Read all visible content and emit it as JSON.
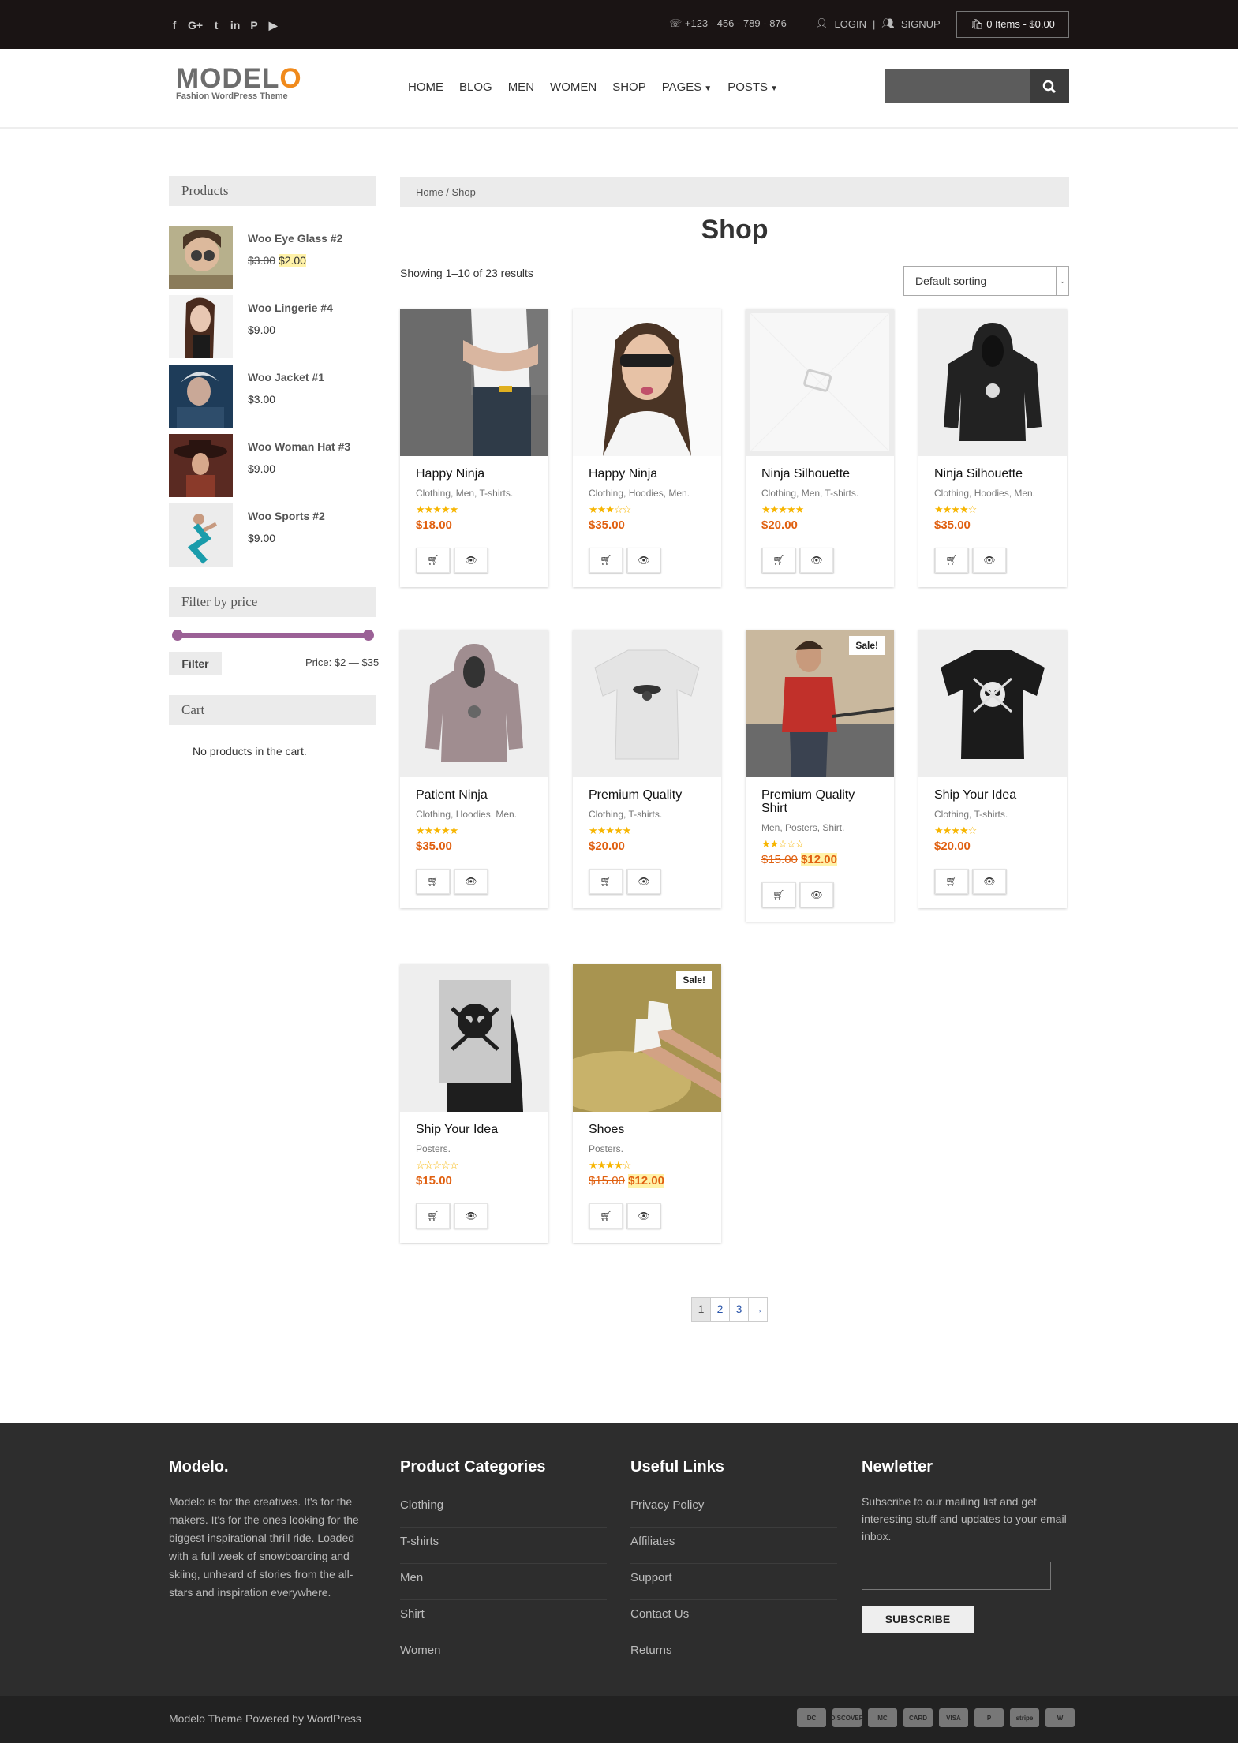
{
  "topbar": {
    "social": [
      "f",
      "G+",
      "t",
      "in",
      "P",
      "▶"
    ],
    "phone": "+123 - 456 - 789 - 876",
    "login": "LOGIN",
    "separator": "|",
    "signup": "SIGNUP",
    "cart": "0 Items - $0.00"
  },
  "header": {
    "logo_main": "MODEL",
    "logo_o": "O",
    "logo_sub": "Fashion WordPress Theme",
    "nav": [
      "HOME",
      "BLOG",
      "MEN",
      "WOMEN",
      "SHOP",
      "PAGES",
      "POSTS"
    ],
    "search_placeholder": ""
  },
  "sidebar": {
    "products_title": "Products",
    "products": [
      {
        "name": "Woo Eye Glass #2",
        "old_price": "$3.00",
        "price": "$2.00"
      },
      {
        "name": "Woo Lingerie #4",
        "price": "$9.00"
      },
      {
        "name": "Woo Jacket #1",
        "price": "$3.00"
      },
      {
        "name": "Woo Woman Hat #3",
        "price": "$9.00"
      },
      {
        "name": "Woo Sports #2",
        "price": "$9.00"
      }
    ],
    "filter_title": "Filter by price",
    "filter_button": "Filter",
    "price_range": "Price: $2 — $35",
    "price_min": 2,
    "price_max": 35,
    "cart_title": "Cart",
    "cart_empty": "No products in the cart."
  },
  "main": {
    "breadcrumb": "Home / Shop",
    "title": "Shop",
    "result_count": "Showing 1–10 of 23 results",
    "sorting": "Default sorting",
    "products": [
      {
        "title": "Happy Ninja",
        "cats": "Clothing, Men, T-shirts.",
        "stars": "★★★★★",
        "price": "$18.00"
      },
      {
        "title": "Happy Ninja",
        "cats": "Clothing, Hoodies, Men.",
        "stars": "★★★☆☆",
        "price": "$35.00"
      },
      {
        "title": "Ninja Silhouette",
        "cats": "Clothing, Men, T-shirts.",
        "stars": "★★★★★",
        "price": "$20.00"
      },
      {
        "title": "Ninja Silhouette",
        "cats": "Clothing, Hoodies, Men.",
        "stars": "★★★★☆",
        "price": "$35.00"
      },
      {
        "title": "Patient Ninja",
        "cats": "Clothing, Hoodies, Men.",
        "stars": "★★★★★",
        "price": "$35.00"
      },
      {
        "title": "Premium Quality",
        "cats": "Clothing, T-shirts.",
        "stars": "★★★★★",
        "price": "$20.00"
      },
      {
        "title": "Premium Quality Shirt",
        "cats": "Men, Posters, Shirt.",
        "stars": "★★☆☆☆",
        "old_price": "$15.00",
        "price": "$12.00",
        "sale": "Sale!"
      },
      {
        "title": "Ship Your Idea",
        "cats": "Clothing, T-shirts.",
        "stars": "★★★★☆",
        "price": "$20.00"
      },
      {
        "title": "Ship Your Idea",
        "cats": "Posters.",
        "stars": "☆☆☆☆☆",
        "price": "$15.00"
      },
      {
        "title": "Shoes",
        "cats": "Posters.",
        "stars": "★★★★☆",
        "old_price": "$15.00",
        "price": "$12.00",
        "sale": "Sale!"
      }
    ],
    "pagination": [
      "1",
      "2",
      "3",
      "→"
    ]
  },
  "footer": {
    "about_title": "Modelo.",
    "about_text": "Modelo is for the creatives. It's for the makers. It's for the ones looking for the biggest inspirational thrill ride. Loaded with a full week of snowboarding and skiing, unheard of stories from the all-stars and inspiration everywhere.",
    "categories_title": "Product Categories",
    "categories": [
      "Clothing",
      "T-shirts",
      "Men",
      "Shirt",
      "Women"
    ],
    "links_title": "Useful Links",
    "links": [
      "Privacy Policy",
      "Affiliates",
      "Support",
      "Contact Us",
      "Returns"
    ],
    "newsletter_title": "Newletter",
    "newsletter_text": "Subscribe to our mailing list and get interesting stuff and updates to your email inbox.",
    "subscribe": "SUBSCRIBE",
    "copyright": "Modelo Theme Powered by WordPress",
    "payments": [
      "DC",
      "DISCOVER",
      "MC",
      "CARD",
      "VISA",
      "P",
      "stripe",
      "W"
    ]
  }
}
